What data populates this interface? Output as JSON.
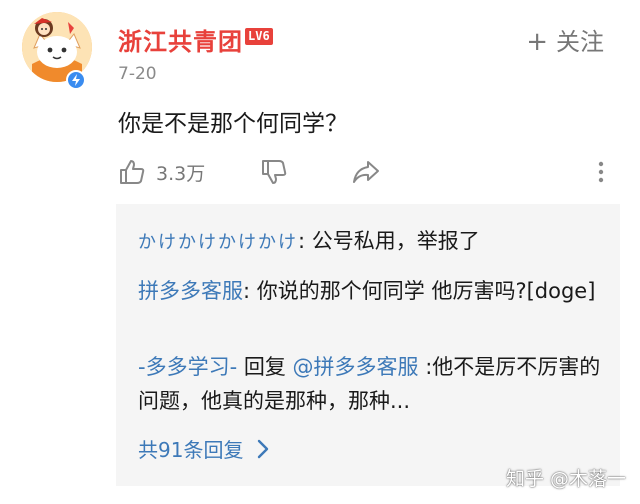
{
  "comment": {
    "author": {
      "name": "浙江共青团",
      "level": "LV6",
      "avatar_icon": "cartoon-girl-cat-avatar",
      "verified_icon": "verified-badge-icon"
    },
    "follow_label": "关注",
    "follow_icon": "plus-icon",
    "date": "7-20",
    "text": "你是不是那个何同学？",
    "actions": {
      "like_count": "3.3万",
      "like_icon": "thumbs-up-icon",
      "dislike_icon": "thumbs-down-icon",
      "share_icon": "share-icon",
      "more_icon": "more-icon"
    }
  },
  "replies": [
    {
      "user": "かけかけかけかけ",
      "separator": ": ",
      "text": "公号私用，举报了"
    },
    {
      "user": "拼多多客服",
      "separator": ": ",
      "text": "你说的那个何同学 他厉害吗?[doge]"
    },
    {
      "user": "-多多学习-",
      "reply_label": " 回复 ",
      "reply_to": "@拼多多客服",
      "separator": " :",
      "text": "他不是厉不厉害的问题，他真的是那种，那种..."
    }
  ],
  "more_replies_label": "共91条回复",
  "watermark": "知乎 @木落一",
  "colors": {
    "author_name": "#e8413b",
    "link_blue": "#3d79b8",
    "muted_gray": "#777777",
    "reply_background": "#f5f5f5"
  }
}
